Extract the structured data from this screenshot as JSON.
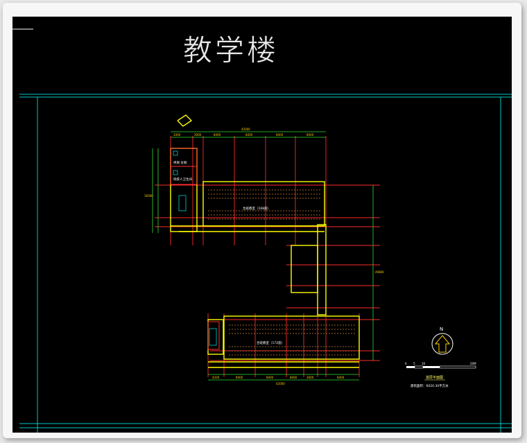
{
  "drawing": {
    "title": "教学楼",
    "compass_label": "N",
    "scale_labels": [
      "0",
      "5",
      "10",
      "20M"
    ],
    "floor_plan_name": "首层平面图",
    "building_area": "建筑面积：6020.30平方米",
    "room_labels": {
      "upper_block": "合班教室（168座）",
      "lower_block": "合班教室（172座）",
      "toilet_1": "男厕 女厕",
      "toilet_2": "残疾人卫生间"
    },
    "top_dims": [
      "3300",
      "3000",
      "8400",
      "8400",
      "8400",
      "8400"
    ],
    "top_total": "42000",
    "bottom_dims": [
      "4200",
      "8400",
      "8400",
      "8400",
      "3000",
      "8400"
    ],
    "bottom_total": "42000",
    "right_total": "49800",
    "left_dims": [
      "4500",
      "4500",
      "6300",
      "3000"
    ],
    "left_total": "18300"
  },
  "colors": {
    "background": "#000000",
    "frame": "#00c8c8",
    "walls": "#ffff00",
    "axes": "#ff3030",
    "text": "#ffd000"
  }
}
